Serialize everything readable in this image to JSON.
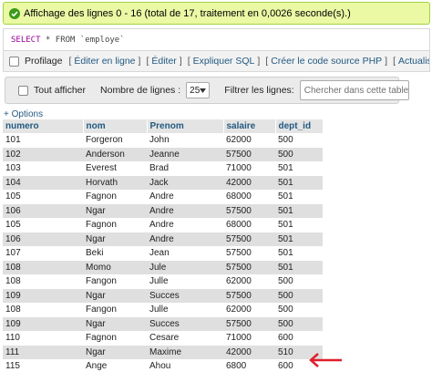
{
  "success": {
    "message": "Affichage des lignes 0 - 16 (total de 17, traitement en 0,0026 seconde(s).)"
  },
  "sql": {
    "keyword": "SELECT",
    "rest": " * FROM `employe`"
  },
  "profile_bar": {
    "profiling_label": "Profilage",
    "links": [
      "Éditer en ligne",
      "Éditer",
      "Expliquer SQL",
      "Créer le code source PHP",
      "Actualiser"
    ]
  },
  "nav": {
    "show_all_label": "Tout afficher",
    "rows_label": "Nombre de lignes :",
    "rows_value": "25",
    "filter_label": "Filtrer les lignes:",
    "search_placeholder": "Chercher dans cette table"
  },
  "options_label": "+ Options",
  "table": {
    "columns": [
      "numero",
      "nom",
      "Prenom",
      "salaire",
      "dept_id"
    ],
    "rows": [
      [
        "101",
        "Forgeron",
        "John",
        "62000",
        "500"
      ],
      [
        "102",
        "Anderson",
        "Jeanne",
        "57500",
        "500"
      ],
      [
        "103",
        "Everest",
        "Brad",
        "71000",
        "501"
      ],
      [
        "104",
        "Horvath",
        "Jack",
        "42000",
        "501"
      ],
      [
        "105",
        "Fagnon",
        "Andre",
        "68000",
        "501"
      ],
      [
        "106",
        "Ngar",
        "Andre",
        "57500",
        "501"
      ],
      [
        "105",
        "Fagnon",
        "Andre",
        "68000",
        "501"
      ],
      [
        "106",
        "Ngar",
        "Andre",
        "57500",
        "501"
      ],
      [
        "107",
        "Beki",
        "Jean",
        "57500",
        "501"
      ],
      [
        "108",
        "Momo",
        "Jule",
        "57500",
        "501"
      ],
      [
        "108",
        "Fangon",
        "Julle",
        "62000",
        "500"
      ],
      [
        "109",
        "Ngar",
        "Succes",
        "57500",
        "500"
      ],
      [
        "108",
        "Fangon",
        "Julle",
        "62000",
        "500"
      ],
      [
        "109",
        "Ngar",
        "Succes",
        "57500",
        "500"
      ],
      [
        "110",
        "Fagnon",
        "Cesare",
        "71000",
        "600"
      ],
      [
        "111",
        "Ngar",
        "Maxime",
        "42000",
        "510"
      ],
      [
        "115",
        "Ange",
        "Ahou",
        "6800",
        "600"
      ]
    ]
  },
  "colors": {
    "success_bg": "#ebf8a4",
    "link": "#235a81",
    "arrow": "#e0202a"
  }
}
